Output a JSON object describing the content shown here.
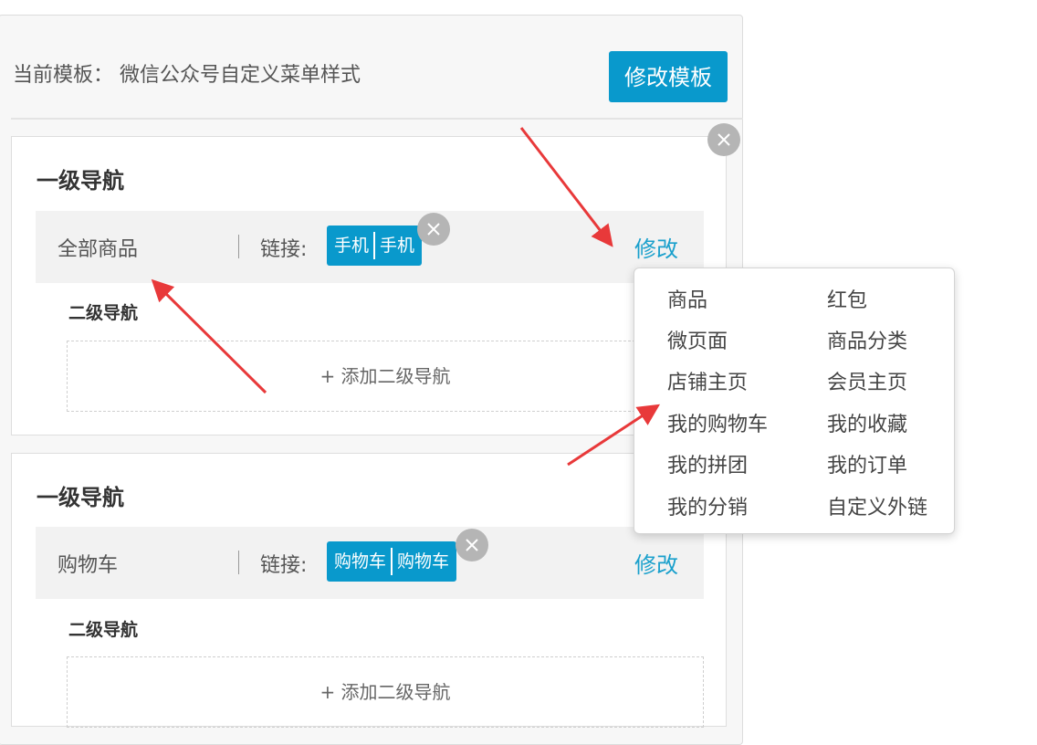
{
  "template": {
    "label": "当前模板： 微信公众号自定义菜单样式",
    "edit_button": "修改模板"
  },
  "menus": [
    {
      "title": "一级导航",
      "name": "全部商品",
      "link_label": "链接:",
      "tag_left": "手机",
      "tag_right": "手机",
      "edit": "修改",
      "sub_title": "二级导航",
      "add_sub": "+ 添加二级导航"
    },
    {
      "title": "一级导航",
      "name": "购物车",
      "link_label": "链接:",
      "tag_left": "购物车",
      "tag_right": "购物车",
      "edit": "修改",
      "sub_title": "二级导航",
      "add_sub": "+ 添加二级导航"
    }
  ],
  "link_menu": {
    "items": [
      "商品",
      "红包",
      "微页面",
      "商品分类",
      "店铺主页",
      "会员主页",
      "我的购物车",
      "我的收藏",
      "我的拼团",
      "我的订单",
      "我的分销",
      "自定义外链"
    ]
  },
  "colors": {
    "accent": "#0999cc",
    "link": "#1aa0cc",
    "annotation_arrow": "#e8393a",
    "close_badge": "#b5b5b5"
  },
  "icons": {
    "close": "close-icon",
    "annotation": "arrow"
  }
}
